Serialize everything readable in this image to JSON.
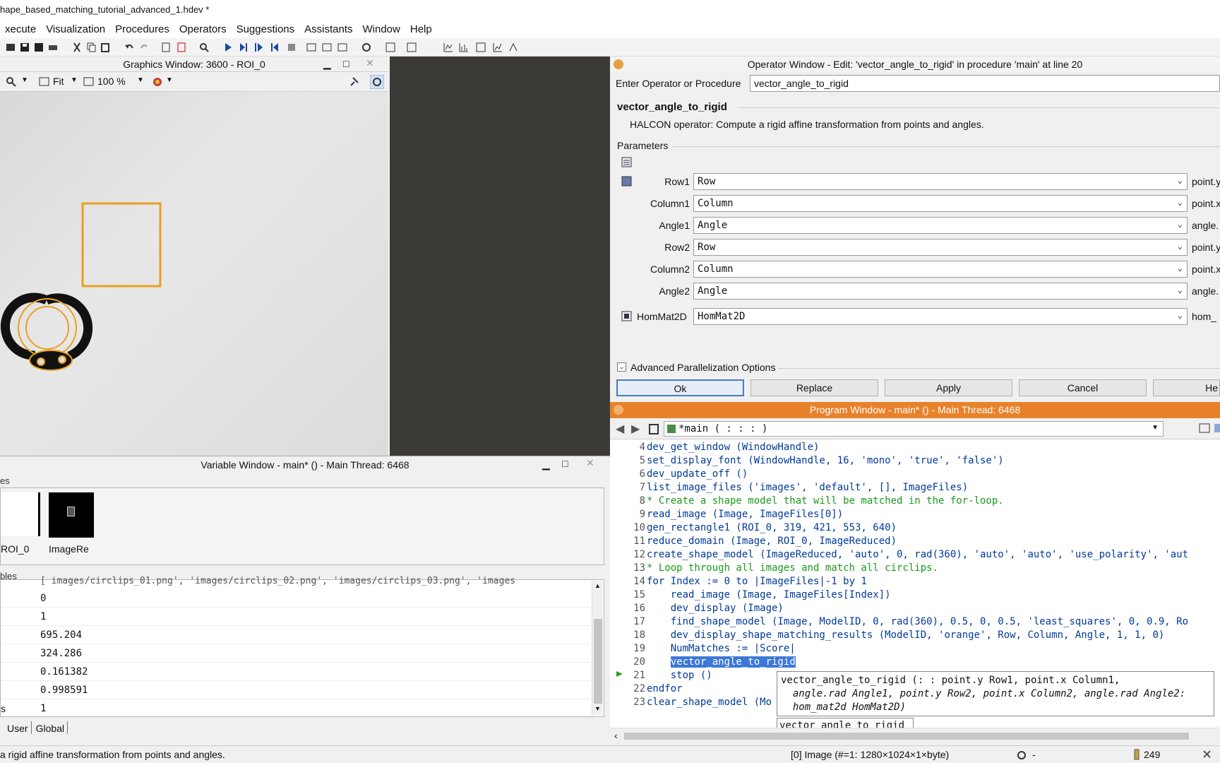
{
  "window_title": "hape_based_matching_tutorial_advanced_1.hdev *",
  "menu": [
    "xecute",
    "Visualization",
    "Procedures",
    "Operators",
    "Suggestions",
    "Assistants",
    "Window",
    "Help"
  ],
  "graphics": {
    "title": "Graphics Window: 3600 - ROI_0",
    "fit_label": "Fit",
    "zoom_label": "100 %",
    "roi_color": "#e8a020"
  },
  "variables": {
    "title": "Variable Window - main* () - Main Thread: 6468",
    "iconic_group": "es",
    "control_group": "bles",
    "iconic_items": [
      {
        "label": "ROI_0"
      },
      {
        "label": "ImageRe"
      }
    ],
    "truncated_row": "[ images/circlips_01.png', 'images/circlips_02.png', 'images/circlips_03.png', 'images",
    "control_rows": [
      {
        "name": "",
        "value": "0"
      },
      {
        "name": "",
        "value": "1"
      },
      {
        "name": "",
        "value": "695.204"
      },
      {
        "name": "",
        "value": "324.286"
      },
      {
        "name": "",
        "value": "0.161382"
      },
      {
        "name": "",
        "value": "0.998591"
      },
      {
        "name": "s",
        "value": "1"
      }
    ],
    "tabs": [
      "User",
      "Global"
    ]
  },
  "operator": {
    "title": "Operator Window - Edit: 'vector_angle_to_rigid' in procedure 'main' at line 20",
    "enter_label": "Enter Operator or Procedure",
    "enter_value": "vector_angle_to_rigid",
    "op_name": "vector_angle_to_rigid",
    "description": "HALCON operator:  Compute a rigid affine transformation from points and angles.",
    "params_label": "Parameters",
    "params": [
      {
        "label": "Row1",
        "value": "Row",
        "unit": "point.y"
      },
      {
        "label": "Column1",
        "value": "Column",
        "unit": "point.x"
      },
      {
        "label": "Angle1",
        "value": "Angle",
        "unit": "angle."
      },
      {
        "label": "Row2",
        "value": "Row",
        "unit": "point.y"
      },
      {
        "label": "Column2",
        "value": "Column",
        "unit": "point.x"
      },
      {
        "label": "Angle2",
        "value": "Angle",
        "unit": "angle."
      }
    ],
    "out_param": {
      "label": "HomMat2D",
      "value": "HomMat2D",
      "unit": "hom_"
    },
    "advanced_label": "Advanced Parallelization Options",
    "buttons": {
      "ok": "Ok",
      "replace": "Replace",
      "apply": "Apply",
      "cancel": "Cancel",
      "help": "He"
    }
  },
  "program": {
    "title": "Program Window - main* () - Main Thread: 6468",
    "procedure": "*main ( : : : )",
    "lines": [
      {
        "n": "4",
        "text": "dev_get_window (WindowHandle)",
        "type": "code",
        "indent": 0
      },
      {
        "n": "5",
        "text": "set_display_font (WindowHandle, 16, 'mono', 'true', 'false')",
        "type": "code",
        "indent": 0
      },
      {
        "n": "6",
        "text": "dev_update_off ()",
        "type": "code",
        "indent": 0
      },
      {
        "n": "7",
        "text": "list_image_files ('images', 'default', [], ImageFiles)",
        "type": "code",
        "indent": 0
      },
      {
        "n": "8",
        "text": "* Create a shape model that will be matched in the for-loop.",
        "type": "comment",
        "indent": 0
      },
      {
        "n": "9",
        "text": "read_image (Image, ImageFiles[0])",
        "type": "code",
        "indent": 0
      },
      {
        "n": "10",
        "text": "gen_rectangle1 (ROI_0, 319, 421, 553, 640)",
        "type": "code",
        "indent": 0
      },
      {
        "n": "11",
        "text": "reduce_domain (Image, ROI_0, ImageReduced)",
        "type": "code",
        "indent": 0
      },
      {
        "n": "12",
        "text": "create_shape_model (ImageReduced, 'auto', 0, rad(360), 'auto', 'auto', 'use_polarity', 'aut",
        "type": "code",
        "indent": 0
      },
      {
        "n": "13",
        "text": "* Loop through all images and match all circlips.",
        "type": "comment",
        "indent": 0
      },
      {
        "n": "14",
        "text": "for Index := 0 to |ImageFiles|-1 by 1",
        "type": "code",
        "indent": 0
      },
      {
        "n": "15",
        "text": "read_image (Image, ImageFiles[Index])",
        "type": "code",
        "indent": 1
      },
      {
        "n": "16",
        "text": "dev_display (Image)",
        "type": "code",
        "indent": 1
      },
      {
        "n": "17",
        "text": "find_shape_model (Image, ModelID, 0, rad(360), 0.5, 0, 0.5, 'least_squares', 0, 0.9, Ro",
        "type": "code",
        "indent": 1
      },
      {
        "n": "18",
        "text": "dev_display_shape_matching_results (ModelID, 'orange', Row, Column, Angle, 1, 1, 0)",
        "type": "code",
        "indent": 1
      },
      {
        "n": "19",
        "text": "NumMatches := |Score|",
        "type": "code",
        "indent": 1
      },
      {
        "n": "20",
        "text": "vector_angle_to_rigid",
        "type": "selected",
        "indent": 1
      },
      {
        "n": "21",
        "text": "stop ()",
        "type": "code",
        "indent": 1
      },
      {
        "n": "22",
        "text": "endfor",
        "type": "code",
        "indent": 0
      },
      {
        "n": "23",
        "text": "clear_shape_model (Mo",
        "type": "code",
        "indent": 0
      }
    ],
    "tooltip_lines": [
      "vector_angle_to_rigid (: : point.y Row1, point.x Column1,",
      "  angle.rad Angle1, point.y Row2, point.x Column2, angle.rad Angle2:",
      "  hom_mat2d HomMat2D)"
    ],
    "autocomplete": "vector_angle_to_rigid"
  },
  "status": {
    "message": "a rigid affine transformation from points and angles.",
    "image_info": "[0] Image (#=1: 1280×1024×1×byte)",
    "timer": "-",
    "memory": "249"
  },
  "colors": {
    "accent_orange": "#e8822a",
    "selection_blue": "#3c78d8",
    "comment_green": "#1a9a1a"
  }
}
